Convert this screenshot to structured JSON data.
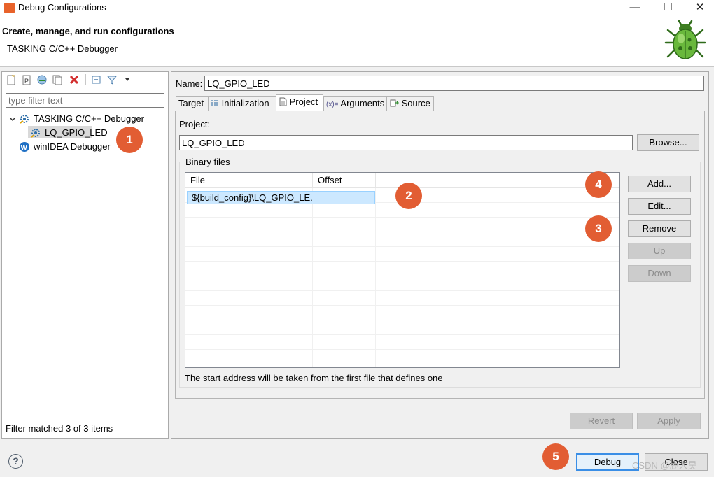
{
  "window": {
    "title": "Debug Configurations",
    "minimize": "—",
    "maximize": "☐",
    "close": "✕"
  },
  "banner": {
    "title": "Create, manage, and run configurations",
    "subtitle": "TASKING C/C++ Debugger"
  },
  "left": {
    "filter_placeholder": "type filter text",
    "tree": [
      {
        "label": "TASKING C/C++ Debugger",
        "expanded": true,
        "icon": "tasking-debugger-icon"
      },
      {
        "label": "LQ_GPIO_LED",
        "selected": true,
        "icon": "launch-config-icon"
      },
      {
        "label": "winIDEA Debugger",
        "icon": "winidea-icon"
      }
    ],
    "filter_status": "Filter matched 3 of 3 items"
  },
  "config": {
    "name_label": "Name:",
    "name_value": "LQ_GPIO_LED",
    "tabs": [
      {
        "label": "Target"
      },
      {
        "label": "Initialization"
      },
      {
        "label": "Project",
        "active": true
      },
      {
        "label": "Arguments"
      },
      {
        "label": "Source"
      }
    ],
    "project_label": "Project:",
    "project_value": "LQ_GPIO_LED",
    "browse_label": "Browse...",
    "binary_files_label": "Binary files",
    "columns": [
      "File",
      "Offset"
    ],
    "rows": [
      {
        "file": "${build_config}\\LQ_GPIO_LE...",
        "offset": ""
      }
    ],
    "buttons": {
      "add": "Add...",
      "edit": "Edit...",
      "remove": "Remove",
      "up": "Up",
      "down": "Down"
    },
    "hint": "The start address will be taken from the first file that defines one",
    "revert": "Revert",
    "apply": "Apply"
  },
  "footer": {
    "help": "?",
    "debug": "Debug",
    "close": "Close"
  },
  "badges": [
    "1",
    "2",
    "3",
    "4",
    "5"
  ],
  "watermark": "CSDN @鹿人昊",
  "colors": {
    "badge": "#e25d33",
    "selection": "#cce8ff",
    "delete_icon": "#d32f2f"
  }
}
